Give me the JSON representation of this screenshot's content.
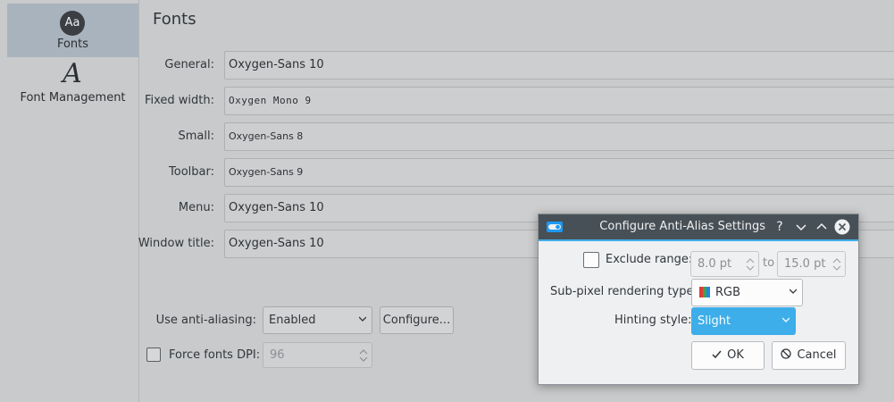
{
  "sidebar": {
    "items": [
      {
        "label": "Fonts",
        "icon": "fonts-icon",
        "active": true
      },
      {
        "label": "Font Management",
        "icon": "font-management-icon",
        "active": false
      }
    ]
  },
  "main": {
    "title": "Fonts",
    "rows": [
      {
        "label": "General:",
        "value": "Oxygen-Sans 10"
      },
      {
        "label": "Fixed width:",
        "value": "Oxygen Mono 9"
      },
      {
        "label": "Small:",
        "value": "Oxygen-Sans 8"
      },
      {
        "label": "Toolbar:",
        "value": "Oxygen-Sans 9"
      },
      {
        "label": "Menu:",
        "value": "Oxygen-Sans 10"
      },
      {
        "label": "Window title:",
        "value": "Oxygen-Sans 10"
      }
    ],
    "antialias": {
      "label": "Use anti-aliasing:",
      "value": "Enabled",
      "configure_label": "Configure..."
    },
    "force_dpi": {
      "label": "Force fonts DPI:",
      "checked": false,
      "value": "96"
    }
  },
  "dialog": {
    "title": "Configure Anti-Alias Settings",
    "titlebar_buttons": {
      "help": "?",
      "minimize": "⌄",
      "maximize": "⌃",
      "close": "✕"
    },
    "exclude_range": {
      "label": "Exclude range:",
      "checked": false,
      "from": "8.0 pt",
      "to_label": "to",
      "to": "15.0 pt"
    },
    "subpixel": {
      "label": "Sub-pixel rendering type:",
      "value": "RGB"
    },
    "hinting": {
      "label": "Hinting style:",
      "value": "Slight"
    },
    "ok_label": "OK",
    "cancel_label": "Cancel"
  },
  "colors": {
    "accent": "#3daee9",
    "titlebar": "#475057",
    "background": "#c9cacb"
  }
}
